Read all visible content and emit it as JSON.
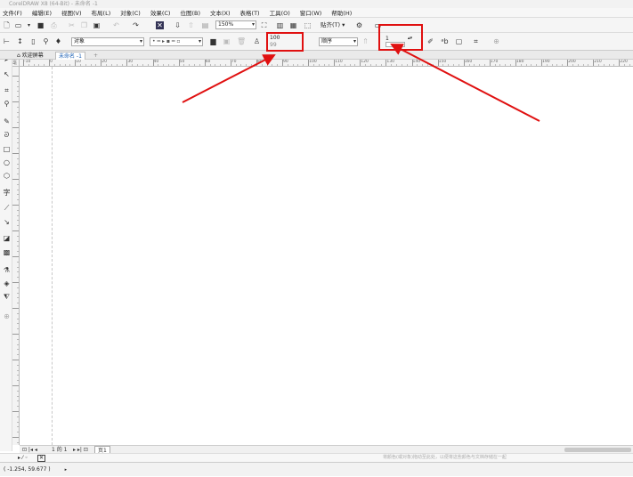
{
  "title": "CorelDRAW X8 (64-Bit) - 未命名 -1",
  "menu": [
    "文件(F)",
    "编辑(E)",
    "视图(V)",
    "布局(L)",
    "对象(C)",
    "效果(C)",
    "位图(B)",
    "文本(X)",
    "表格(T)",
    "工具(O)",
    "窗口(W)",
    "帮助(H)"
  ],
  "toolbar1": {
    "zoom": "150%",
    "snap_label": "贴齐(T)"
  },
  "propbar": {
    "object_label": "对象",
    "line_style": "",
    "transparency_top": "100",
    "transparency_bottom": "99",
    "order_label": "顺序",
    "spin_value": "1",
    "spin_value_2": ""
  },
  "tabs": {
    "welcome": "欢迎屏幕",
    "doc": "未命名 -1"
  },
  "ruler": {
    "unit": "毫米",
    "ticks": [
      "-10",
      "0",
      "10",
      "20",
      "30",
      "40",
      "50",
      "60",
      "70",
      "80",
      "90",
      "100",
      "110",
      "120",
      "130",
      "140",
      "150",
      "160",
      "170",
      "180",
      "190",
      "200",
      "210",
      "220"
    ]
  },
  "pagenav": {
    "counter": "1 的 1",
    "page": "页1"
  },
  "palette_hint": "将颜色(或对象)拖动至此处，以便将这些颜色与文档存储在一起",
  "status": {
    "coords": "( -1.254, 59.677 )"
  },
  "colors": {
    "annotation": "#e01010"
  }
}
